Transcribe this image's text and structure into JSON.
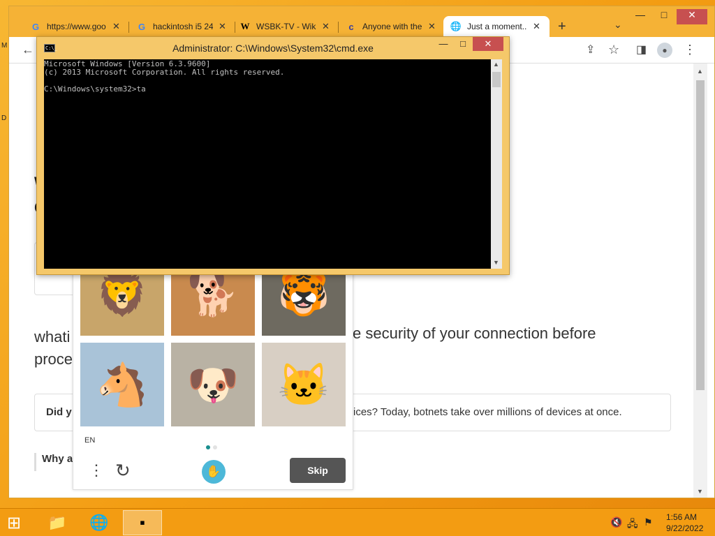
{
  "desktop": {
    "edge_labels": [
      "M",
      "D"
    ]
  },
  "browser": {
    "tabs": [
      {
        "title": "https://www.goo",
        "icon": "G"
      },
      {
        "title": "hackintosh i5 24",
        "icon": "G"
      },
      {
        "title": "WSBK-TV - Wiki",
        "icon": "W"
      },
      {
        "title": "Anyone with the",
        "icon": "c"
      },
      {
        "title": "Just a moment...",
        "icon": "globe"
      }
    ],
    "new_tab": "+",
    "window_controls": {
      "minimize": "—",
      "maximize": "□",
      "close": "✕"
    }
  },
  "page": {
    "heading_fragments": [
      "W",
      "C"
    ],
    "main_left": "whati",
    "main_left2": "proce",
    "main_right": "e security of your connection before",
    "didyou_left": "Did y",
    "didyou_right": "ices? Today, botnets take over millions of devices at once.",
    "why_line": "Why a"
  },
  "captcha": {
    "language": "EN",
    "skip_label": "Skip",
    "tiles": [
      {
        "name": "lion",
        "glyph": "🦁"
      },
      {
        "name": "dog",
        "glyph": "🐕"
      },
      {
        "name": "tiger",
        "glyph": "🐯"
      },
      {
        "name": "horse",
        "glyph": "🐴"
      },
      {
        "name": "beagle",
        "glyph": "🐶"
      },
      {
        "name": "cat",
        "glyph": "🐱"
      }
    ]
  },
  "cmd": {
    "title": "Administrator: C:\\Windows\\System32\\cmd.exe",
    "icon_text": "C:\\_",
    "lines": [
      "Microsoft Windows [Version 6.3.9600]",
      "(c) 2013 Microsoft Corporation. All rights reserved.",
      "",
      "C:\\Windows\\system32>ta"
    ]
  },
  "taskbar": {
    "time": "1:56 AM",
    "date": "9/22/2022"
  },
  "colors": {
    "accent": "#f39c12",
    "captcha_accent": "#1a8e8e",
    "close_red": "#c75050"
  }
}
